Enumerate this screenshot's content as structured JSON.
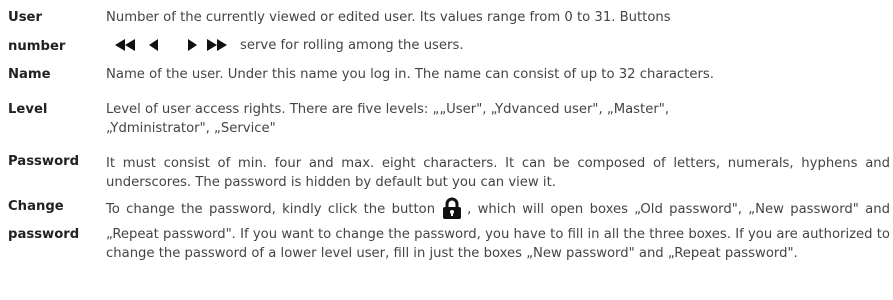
{
  "rows": {
    "user_number": {
      "term_line1": "User",
      "term_line2": "number",
      "desc_line1": "Number of the currently viewed or edited user. Its values range from 0 to 31. Buttons",
      "desc_line2": "serve for rolling among the users.",
      "icons": [
        "rewind-icon",
        "previous-icon",
        "next-icon",
        "fast-forward-icon"
      ]
    },
    "name": {
      "term": "Name",
      "desc": "Name of the user. Under this name you log in. The name can consist of up to 32 characters."
    },
    "level": {
      "term": "Level",
      "desc_line1": "Level of user access rights. There are five levels: „„User\", „Ydvanced user\", „Master\",",
      "desc_line2": "„Ydministrator\", „Service\""
    },
    "password": {
      "term": "Password",
      "desc": "It must consist of min. four and max. eight characters. It can be composed of letters, numerals, hyphens and underscores. The password is hidden by default but you can view it."
    },
    "change_password": {
      "term_line1": "Change",
      "term_line2": "password",
      "desc_before_icon": "To change the password, kindly click the button",
      "desc_after_icon": ", which will open boxes „Old password\", „New password\" and „Repeat password\". If you want to change the password, you have to fill in all the three boxes. If you are authorized to change the password of a lower level user, fill in just the boxes „New password\" and „Repeat password\".",
      "icon": "lock-icon"
    }
  },
  "colors": {
    "term": "#222222",
    "text": "#444444",
    "icon": "#111111"
  }
}
